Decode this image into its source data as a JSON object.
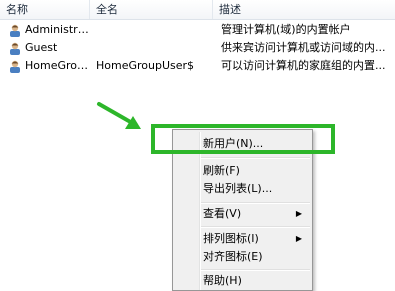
{
  "columns": {
    "name": "名称",
    "full_name": "全名",
    "description": "描述"
  },
  "users": [
    {
      "name": "Administrat...",
      "full_name": "",
      "description": "管理计算机(域)的内置帐户"
    },
    {
      "name": "Guest",
      "full_name": "",
      "description": "供来宾访问计算机或访问域的内..."
    },
    {
      "name": "HomeGrou...",
      "full_name": "HomeGroupUser$",
      "description": "可以访问计算机的家庭组的内置..."
    }
  ],
  "context_menu": {
    "new_user": "新用户(N)...",
    "refresh": "刷新(F)",
    "export_list": "导出列表(L)...",
    "view": "查看(V)",
    "arrange_icons": "排列图标(I)",
    "align_icons": "对齐图标(E)",
    "help": "帮助(H)"
  },
  "colors": {
    "highlight": "#2db62a",
    "arrow": "#2db62a"
  },
  "icons": {
    "user": "user-icon",
    "submenu": "submenu-arrow-icon"
  }
}
